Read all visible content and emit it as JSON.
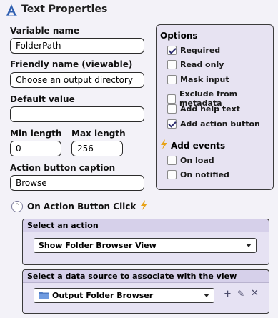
{
  "header": {
    "title": "Text Properties",
    "icon": "text-a-icon"
  },
  "fields": {
    "variable_name": {
      "label": "Variable name",
      "value": "FolderPath"
    },
    "friendly_name": {
      "label": "Friendly name (viewable)",
      "value": "Choose an output directory"
    },
    "default_value": {
      "label": "Default value",
      "value": ""
    },
    "min_length": {
      "label": "Min length",
      "value": "0"
    },
    "max_length": {
      "label": "Max length",
      "value": "256"
    },
    "action_caption": {
      "label": "Action button caption",
      "value": "Browse"
    }
  },
  "options": {
    "title": "Options",
    "items": [
      {
        "label": "Required",
        "checked": true
      },
      {
        "label": "Read only",
        "checked": false
      },
      {
        "label": "Mask input",
        "checked": false
      },
      {
        "label": "Exclude from metadata",
        "checked": false
      },
      {
        "label": "Add help text",
        "checked": false
      },
      {
        "label": "Add action button",
        "checked": true
      }
    ],
    "events_title": "Add events",
    "events": [
      {
        "label": "On load",
        "checked": false
      },
      {
        "label": "On notified",
        "checked": false
      }
    ]
  },
  "on_action": {
    "label": "On Action Button Click",
    "select_action": {
      "header": "Select an action",
      "value": "Show Folder Browser View"
    },
    "select_source": {
      "header": "Select a data source to associate with the view",
      "value": "Output Folder Browser"
    }
  },
  "colors": {
    "panel": "#e7e3f2",
    "section_head": "#d6d0ea",
    "bolt": "#e8a317",
    "icon_blue": "#2f5fb0"
  }
}
